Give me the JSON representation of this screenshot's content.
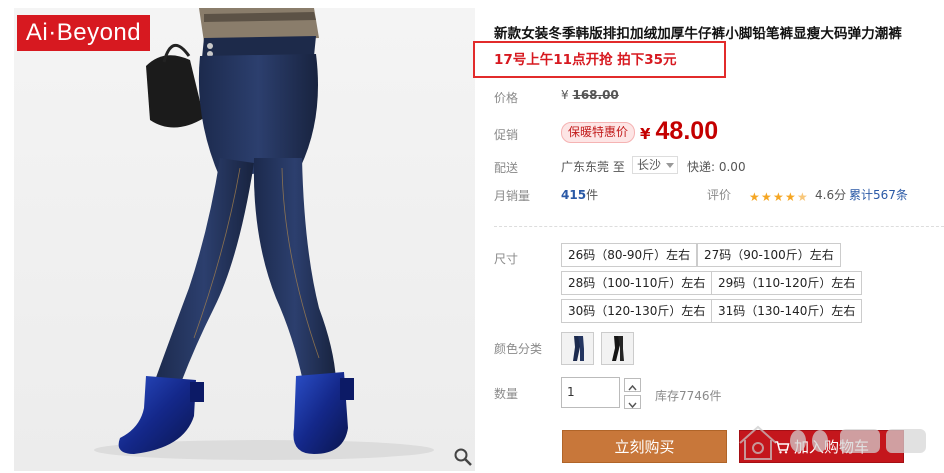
{
  "brand": {
    "logo_text": "Ai·Beyond"
  },
  "product": {
    "title": "新款女装冬季韩版排扣加绒加厚牛仔裤小脚铅笔裤显瘦大码弹力潮裤",
    "promo": "17号上午11点开抢 拍下35元"
  },
  "price": {
    "label": "价格",
    "currency": "¥",
    "original": "168.00"
  },
  "promotion": {
    "label": "促销",
    "tag": "保暖特惠价",
    "currency": "¥",
    "price": "48.00"
  },
  "shipping": {
    "label": "配送",
    "from": "广东东莞",
    "to_prefix": "至",
    "to": "长沙",
    "fee": "快递: 0.00"
  },
  "sales": {
    "label": "月销量",
    "count": "415",
    "unit": "件",
    "rating_label": "评价",
    "rating": "4.6分",
    "stars": 4.5,
    "reviews": "累计567条"
  },
  "size": {
    "label": "尺寸",
    "options": [
      "26码（80-90斤）左右",
      "27码（90-100斤）左右",
      "28码（100-110斤）左右",
      "29码（110-120斤）左右",
      "30码（120-130斤）左右",
      "31码（130-140斤）左右"
    ]
  },
  "color": {
    "label": "颜色分类"
  },
  "quantity": {
    "label": "数量",
    "value": "1",
    "stock": "库存7746件"
  },
  "actions": {
    "buy": "立刻购买",
    "cart": "加入购物车"
  },
  "colors": {
    "accent_red": "#c40000",
    "buy_orange": "#c8773a",
    "cart_red": "#c4161c",
    "promo_border": "#e22b2b",
    "link_blue": "#2a59a6"
  }
}
